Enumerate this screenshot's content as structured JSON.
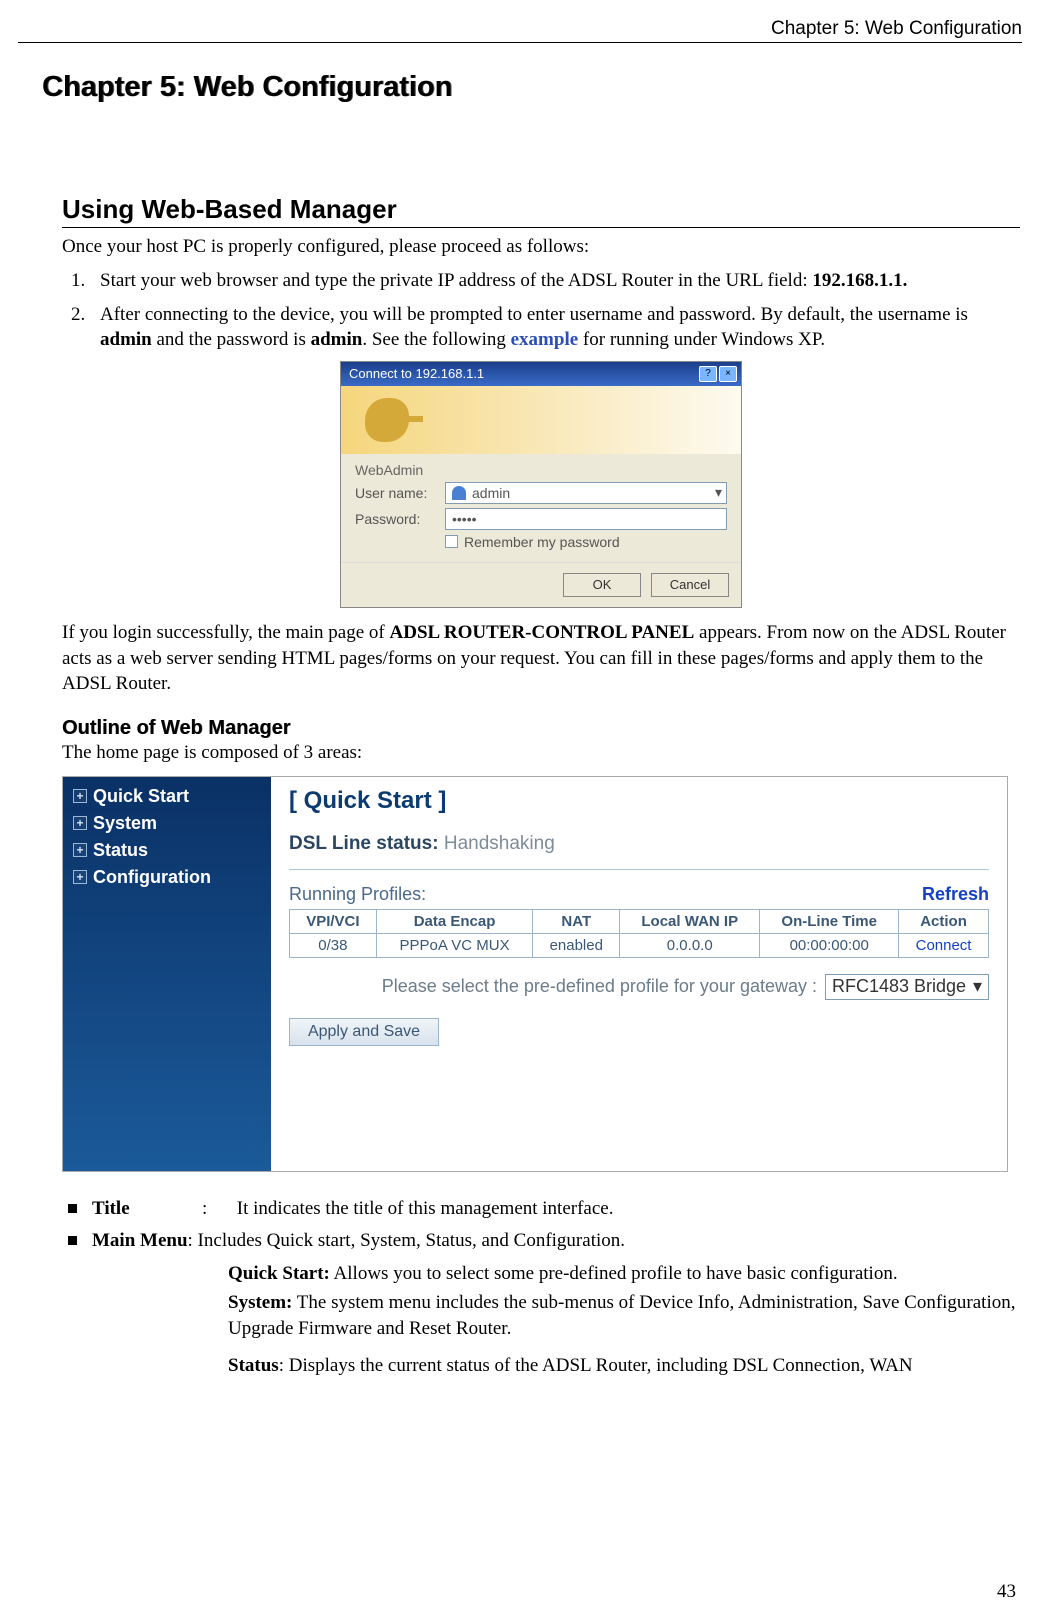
{
  "header": {
    "running": "Chapter 5: Web Configuration"
  },
  "chapter_title": "Chapter 5: Web Configuration",
  "section1": {
    "title": "Using Web-Based Manager",
    "intro": "Once your host PC is properly configured, please proceed as follows:",
    "step1_a": "Start your web browser and type the private IP address of the ADSL Router in the URL field: ",
    "step1_b": "192.168.1.1.",
    "step2_a": "After connecting to the device, you will be prompted to enter username and password. By default, the username is ",
    "step2_b": "admin",
    "step2_c": " and the password is ",
    "step2_d": "admin",
    "step2_e": ". See the following ",
    "step2_f": "example",
    "step2_g": " for running under Windows XP."
  },
  "login": {
    "titlebar": "Connect to 192.168.1.1",
    "help_btn": "?",
    "close_btn": "×",
    "realm": "WebAdmin",
    "user_label": "User name:",
    "user_value": "admin",
    "pass_label": "Password:",
    "pass_value": "•••••",
    "remember": "Remember my password",
    "ok": "OK",
    "cancel": "Cancel"
  },
  "post_login_a": "If you login successfully, the main page of ",
  "post_login_b": "ADSL ROUTER-CONTROL PANEL",
  "post_login_c": " appears. From now on the ADSL Router acts as a web server sending HTML pages/forms on your request. You can fill in these pages/forms and apply them to the ADSL Router.",
  "outline": {
    "heading": "Outline of Web Manager",
    "intro": "The home page is composed of 3 areas:"
  },
  "router": {
    "menu": [
      "Quick Start",
      "System",
      "Status",
      "Configuration"
    ],
    "panel_title": "[ Quick Start ]",
    "dsl_label": "DSL Line status: ",
    "dsl_value": "Handshaking",
    "running_profiles": "Running Profiles:",
    "refresh": "Refresh",
    "headers": [
      "VPI/VCI",
      "Data Encap",
      "NAT",
      "Local WAN IP",
      "On-Line Time",
      "Action"
    ],
    "row": [
      "0/38",
      "PPPoA  VC MUX",
      "enabled",
      "0.0.0.0",
      "00:00:00:00"
    ],
    "row_action": "Connect",
    "select_text": "Please select the pre-defined profile for your gateway :",
    "select_value": "RFC1483 Bridge",
    "apply": "Apply and Save"
  },
  "desc": {
    "title_label": "Title",
    "title_colon": ":",
    "title_text": "It indicates the title of this management interface.",
    "main_menu_label": "Main Menu",
    "main_menu_text": ": Includes Quick start, System, Status, and Configuration.",
    "qs_label": "Quick Start:",
    "qs_text": " Allows you to select some pre-defined profile to have basic configuration.",
    "sys_label": "System:",
    "sys_text": " The system menu includes the sub-menus of Device Info, Administration, Save Configuration, Upgrade Firmware and Reset Router.",
    "status_label": "Status",
    "status_text": ": Displays the current status of the ADSL Router, including DSL Connection, WAN"
  },
  "page_number": "43"
}
